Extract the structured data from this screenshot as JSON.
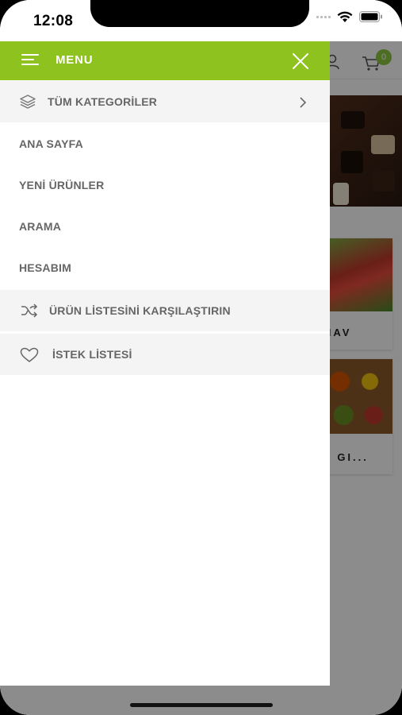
{
  "status_bar": {
    "time": "12:08"
  },
  "background_app": {
    "cart_count": "0",
    "card_labels": [
      "NAV",
      "L GI..."
    ]
  },
  "drawer": {
    "title": "MENU",
    "items": [
      {
        "label": "TÜM KATEGORİLER",
        "icon": "layers-icon",
        "trailing": "chevron-right-icon"
      },
      {
        "label": "ANA SAYFA"
      },
      {
        "label": "YENİ ÜRÜNLER"
      },
      {
        "label": "ARAMA"
      },
      {
        "label": "HESABIM"
      },
      {
        "label": "ÜRÜN LİSTESİNİ KARŞILAŞTIRIN",
        "icon": "shuffle-icon"
      },
      {
        "label": "İSTEK LİSTESİ",
        "icon": "heart-icon"
      }
    ]
  },
  "colors": {
    "accent": "#8dc21f",
    "badge": "#8cc63f",
    "text": "#666666"
  }
}
